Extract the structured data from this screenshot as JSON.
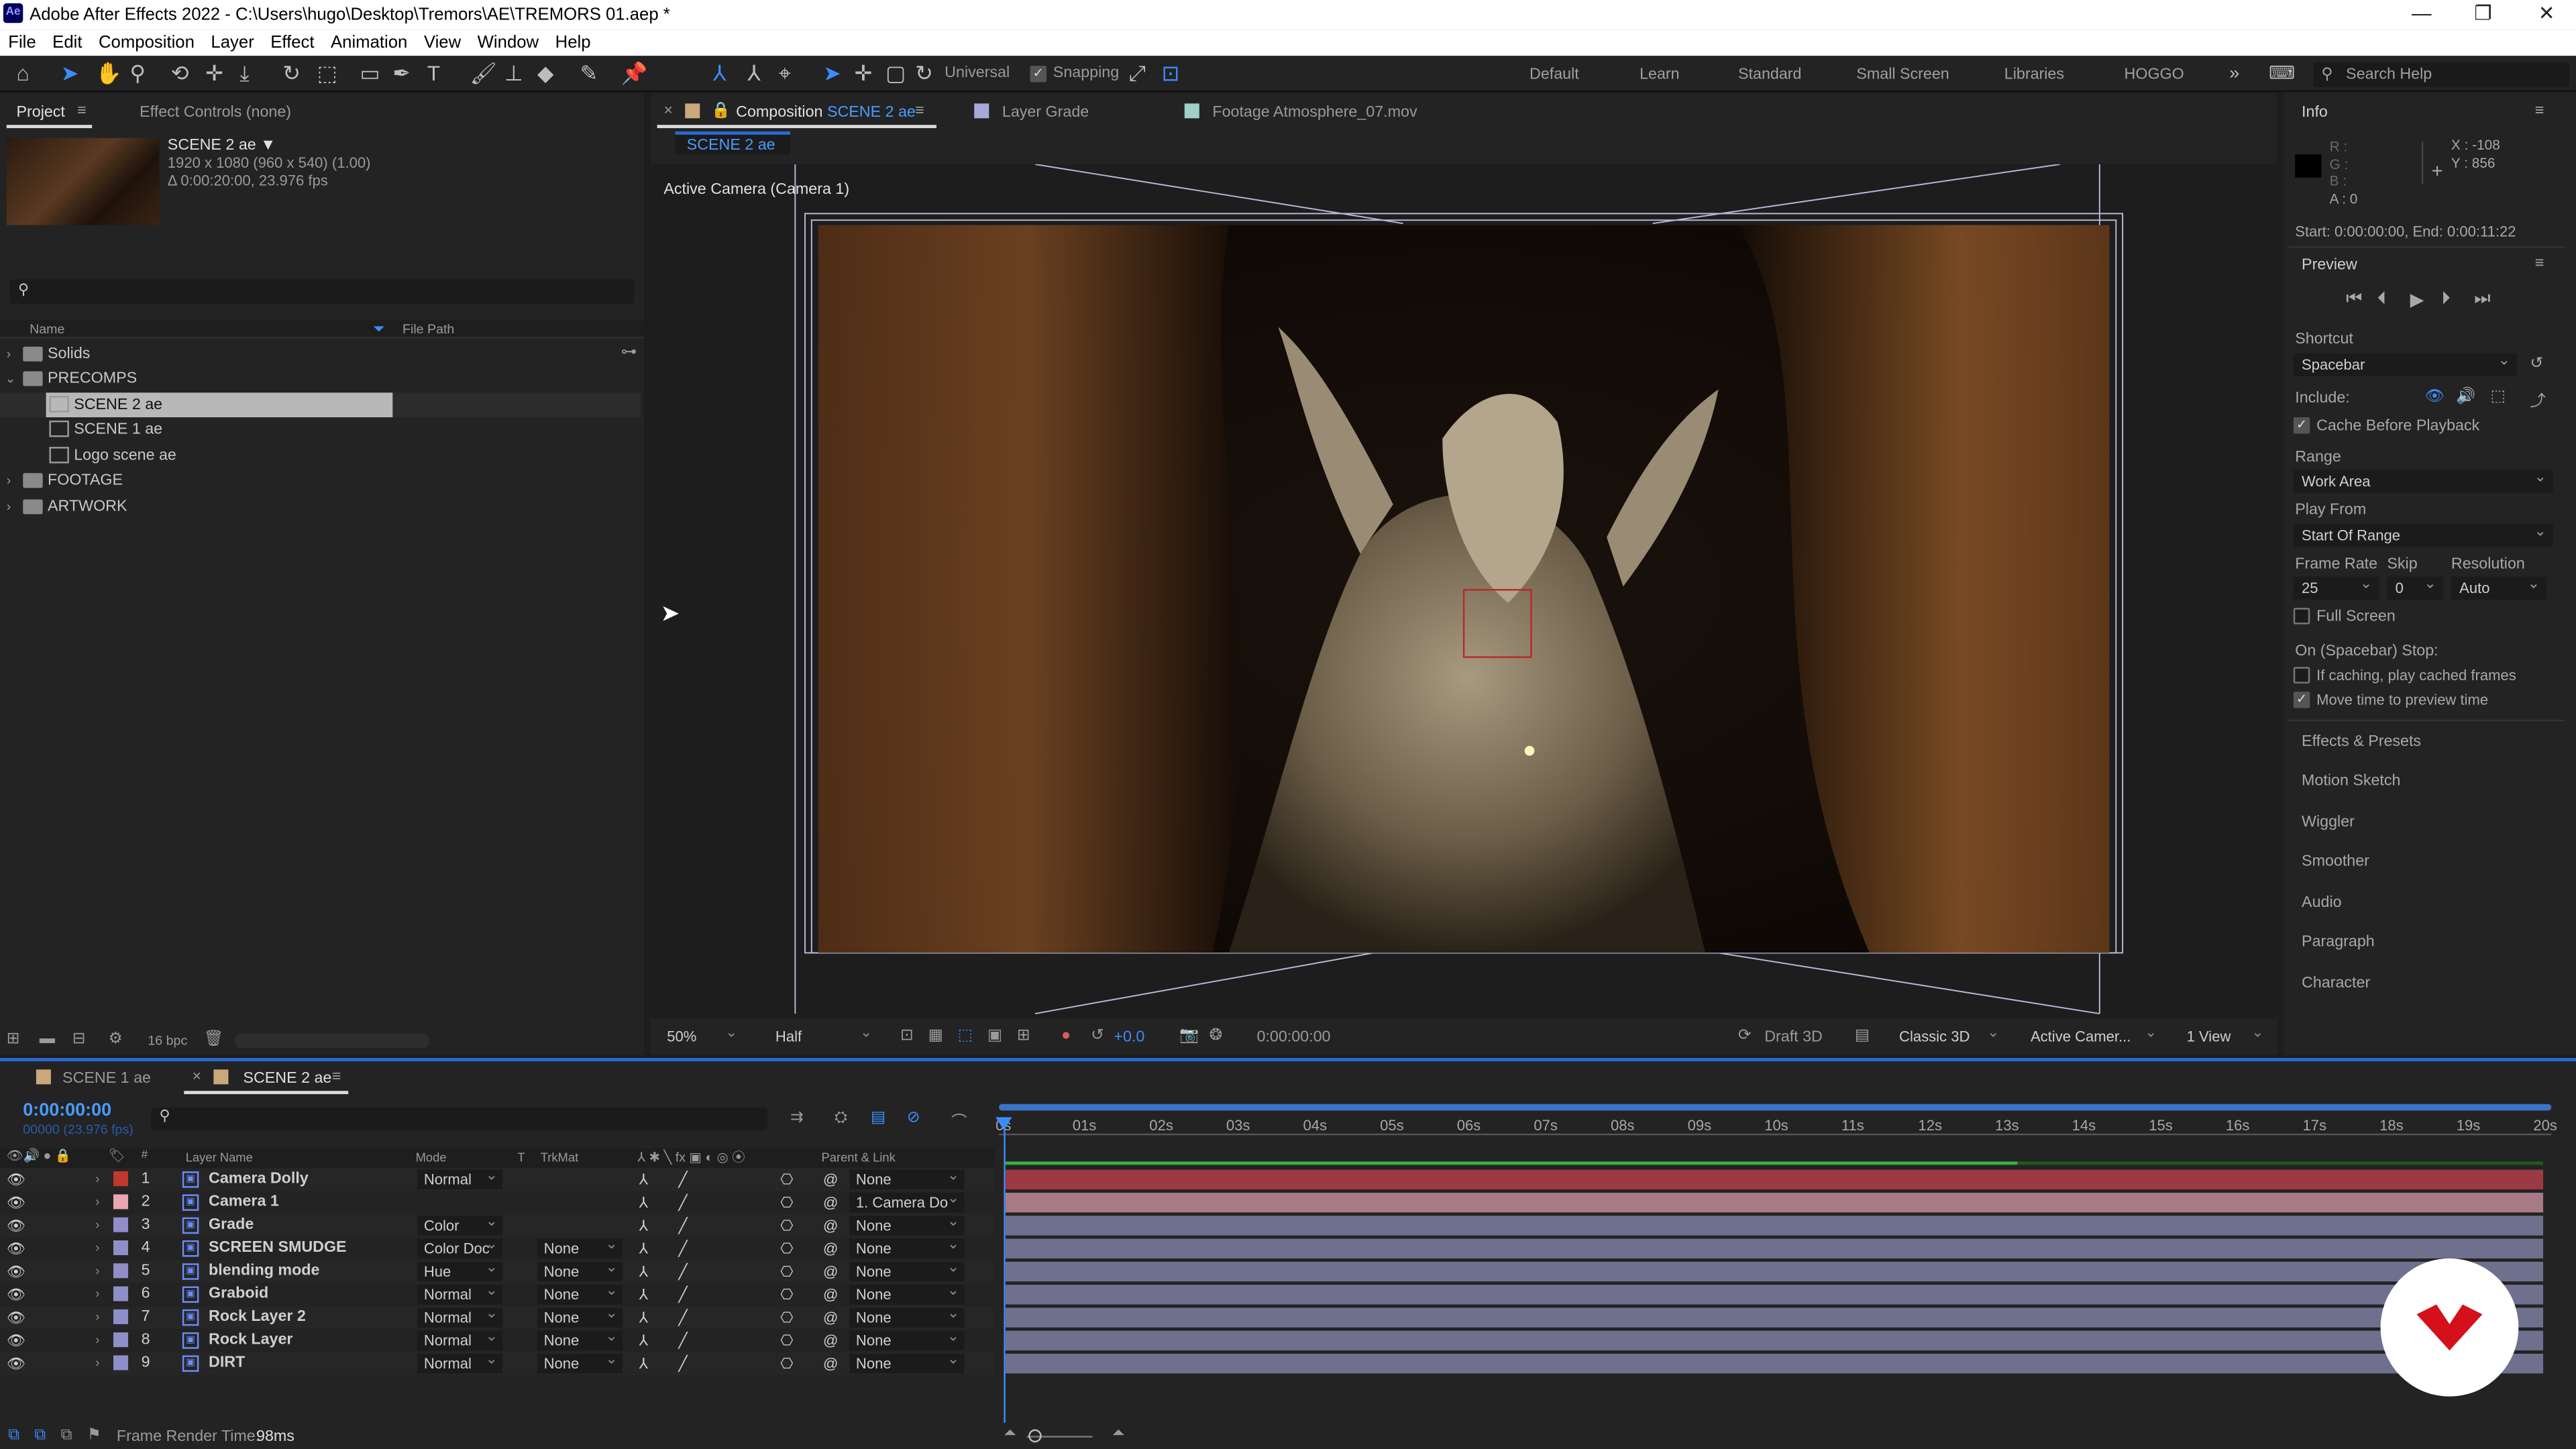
{
  "window": {
    "title": "Adobe After Effects 2022 - C:\\Users\\hugo\\Desktop\\Tremors\\AE\\TREMORS 01.aep *",
    "app_icon": "Ae"
  },
  "menu": [
    "File",
    "Edit",
    "Composition",
    "Layer",
    "Effect",
    "Animation",
    "View",
    "Window",
    "Help"
  ],
  "toolbar": {
    "universal_label": "Universal",
    "snapping_label": "Snapping",
    "search_help_placeholder": "Search Help"
  },
  "workspaces": [
    "Default",
    "Learn",
    "Standard",
    "Small Screen",
    "Libraries",
    "HOGGO"
  ],
  "project": {
    "tab_label": "Project",
    "effect_controls_label": "Effect Controls (none)",
    "comp_name": "SCENE 2 ae ▼",
    "comp_dims": "1920 x 1080  (960 x 540) (1.00)",
    "comp_dur": "Δ 0:00:20:00, 23.976 fps",
    "col_name": "Name",
    "col_path": "File Path",
    "items": [
      {
        "label": "Solids",
        "type": "folder",
        "open": false
      },
      {
        "label": "PRECOMPS",
        "type": "folder",
        "open": true
      },
      {
        "label": "SCENE 2 ae",
        "type": "comp",
        "selected": true
      },
      {
        "label": "SCENE 1 ae",
        "type": "comp"
      },
      {
        "label": "Logo scene ae",
        "type": "comp"
      },
      {
        "label": "FOOTAGE",
        "type": "folder",
        "open": false
      },
      {
        "label": "ARTWORK",
        "type": "folder",
        "open": false
      }
    ],
    "bpc": "16 bpc"
  },
  "comp_panel": {
    "tab_prefix": "Composition",
    "tab_comp": "SCENE 2 ae",
    "layer_tab": "Layer Grade",
    "footage_tab": "Footage Atmosphere_07.mov",
    "breadcrumb": "SCENE 2 ae",
    "camera_label": "Active Camera (Camera 1)",
    "footer": {
      "zoom": "50%",
      "resolution": "Half",
      "exposure": "+0.0",
      "timecode": "0:00:00:00",
      "draft3d": "Draft 3D",
      "renderer": "Classic 3D",
      "camera": "Active Camer...",
      "views": "1 View"
    }
  },
  "info": {
    "title": "Info",
    "r": "R :",
    "g": "G :",
    "b": "B :",
    "a": "A : 0",
    "x": "X : -108",
    "y": "Y : 856",
    "range": "Start: 0:00:00:00, End: 0:00:11:22"
  },
  "preview": {
    "title": "Preview",
    "shortcut_label": "Shortcut",
    "shortcut_value": "Spacebar",
    "include_label": "Include:",
    "cache_label": "Cache Before Playback",
    "range_label": "Range",
    "range_value": "Work Area",
    "playfrom_label": "Play From",
    "playfrom_value": "Start Of Range",
    "framerate_label": "Frame Rate",
    "skip_label": "Skip",
    "resolution_label": "Resolution",
    "framerate_value": "25",
    "skip_value": "0",
    "resolution_value": "Auto",
    "fullscreen_label": "Full Screen",
    "stop_label": "On (Spacebar) Stop:",
    "ifcaching_label": "If caching, play cached frames",
    "movetime_label": "Move time to preview time"
  },
  "side_panels": [
    "Effects & Presets",
    "Motion Sketch",
    "Wiggler",
    "Smoother",
    "Audio",
    "Paragraph",
    "Character"
  ],
  "timeline": {
    "tabs": [
      "SCENE 1 ae",
      "SCENE 2 ae"
    ],
    "timecode": "0:00:00:00",
    "frames": "00000 (23.976 fps)",
    "col_layer": "Layer Name",
    "col_mode": "Mode",
    "col_t": "T",
    "col_trkmat": "TrkMat",
    "col_parent": "Parent & Link",
    "ruler": [
      "0s",
      "01s",
      "02s",
      "03s",
      "04s",
      "05s",
      "06s",
      "07s",
      "08s",
      "09s",
      "10s",
      "11s",
      "12s",
      "13s",
      "14s",
      "15s",
      "16s",
      "17s",
      "18s",
      "19s",
      "20s"
    ],
    "layers": [
      {
        "num": "1",
        "name": "Camera Dolly",
        "mode": "Normal",
        "trkmat": "",
        "parent": "None",
        "color": "#c0392b",
        "bar": "#9b3a44"
      },
      {
        "num": "2",
        "name": "Camera 1",
        "mode": "",
        "trkmat": "",
        "parent": "1. Camera Do",
        "color": "#e8a7b0",
        "bar": "#a87a86"
      },
      {
        "num": "3",
        "name": "Grade",
        "mode": "Color",
        "trkmat": "",
        "parent": "None",
        "color": "#8e8ec8",
        "bar": "#6f6f8e"
      },
      {
        "num": "4",
        "name": "SCREEN SMUDGE",
        "mode": "Color Doc",
        "trkmat": "None",
        "parent": "None",
        "color": "#8e8ec8",
        "bar": "#6f6f8e"
      },
      {
        "num": "5",
        "name": "blending mode",
        "mode": "Hue",
        "trkmat": "None",
        "parent": "None",
        "color": "#8e8ec8",
        "bar": "#6f6f8e"
      },
      {
        "num": "6",
        "name": "Graboid",
        "mode": "Normal",
        "trkmat": "None",
        "parent": "None",
        "color": "#8e8ec8",
        "bar": "#6f6f8e"
      },
      {
        "num": "7",
        "name": "Rock Layer 2",
        "mode": "Normal",
        "trkmat": "None",
        "parent": "None",
        "color": "#8e8ec8",
        "bar": "#6f6f8e"
      },
      {
        "num": "8",
        "name": "Rock Layer",
        "mode": "Normal",
        "trkmat": "None",
        "parent": "None",
        "color": "#8e8ec8",
        "bar": "#6f6f8e"
      },
      {
        "num": "9",
        "name": "DIRT",
        "mode": "Normal",
        "trkmat": "None",
        "parent": "None",
        "color": "#8e8ec8",
        "bar": "#6f6f8e"
      }
    ]
  },
  "status": {
    "frame_render_label": "Frame Render Time:",
    "frame_render_value": "98ms"
  }
}
